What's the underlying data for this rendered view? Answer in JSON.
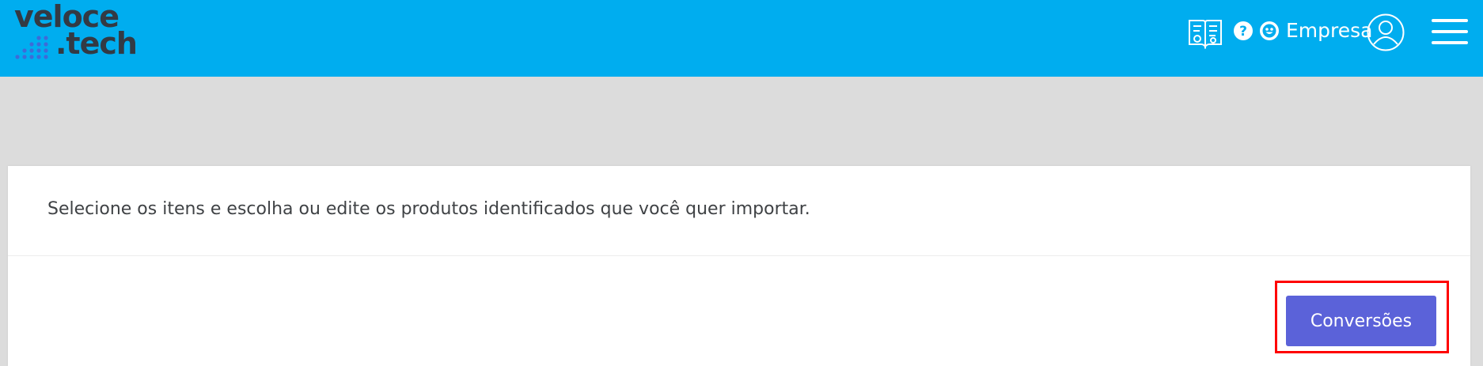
{
  "header": {
    "logo_line1": "veloce",
    "logo_line2": ".tech",
    "company_label": "Empresa",
    "icons": [
      "manual-icon",
      "help-icon",
      "smile-icon",
      "user-avatar-icon",
      "hamburger-menu-icon"
    ],
    "background_color": "#00adef"
  },
  "main": {
    "instruction": "Selecione os itens e escolha ou edite os produtos identificados que você quer importar.",
    "conversions_button_label": "Conversões",
    "button_color": "#5b62d9",
    "highlight_color": "#ff0000"
  }
}
